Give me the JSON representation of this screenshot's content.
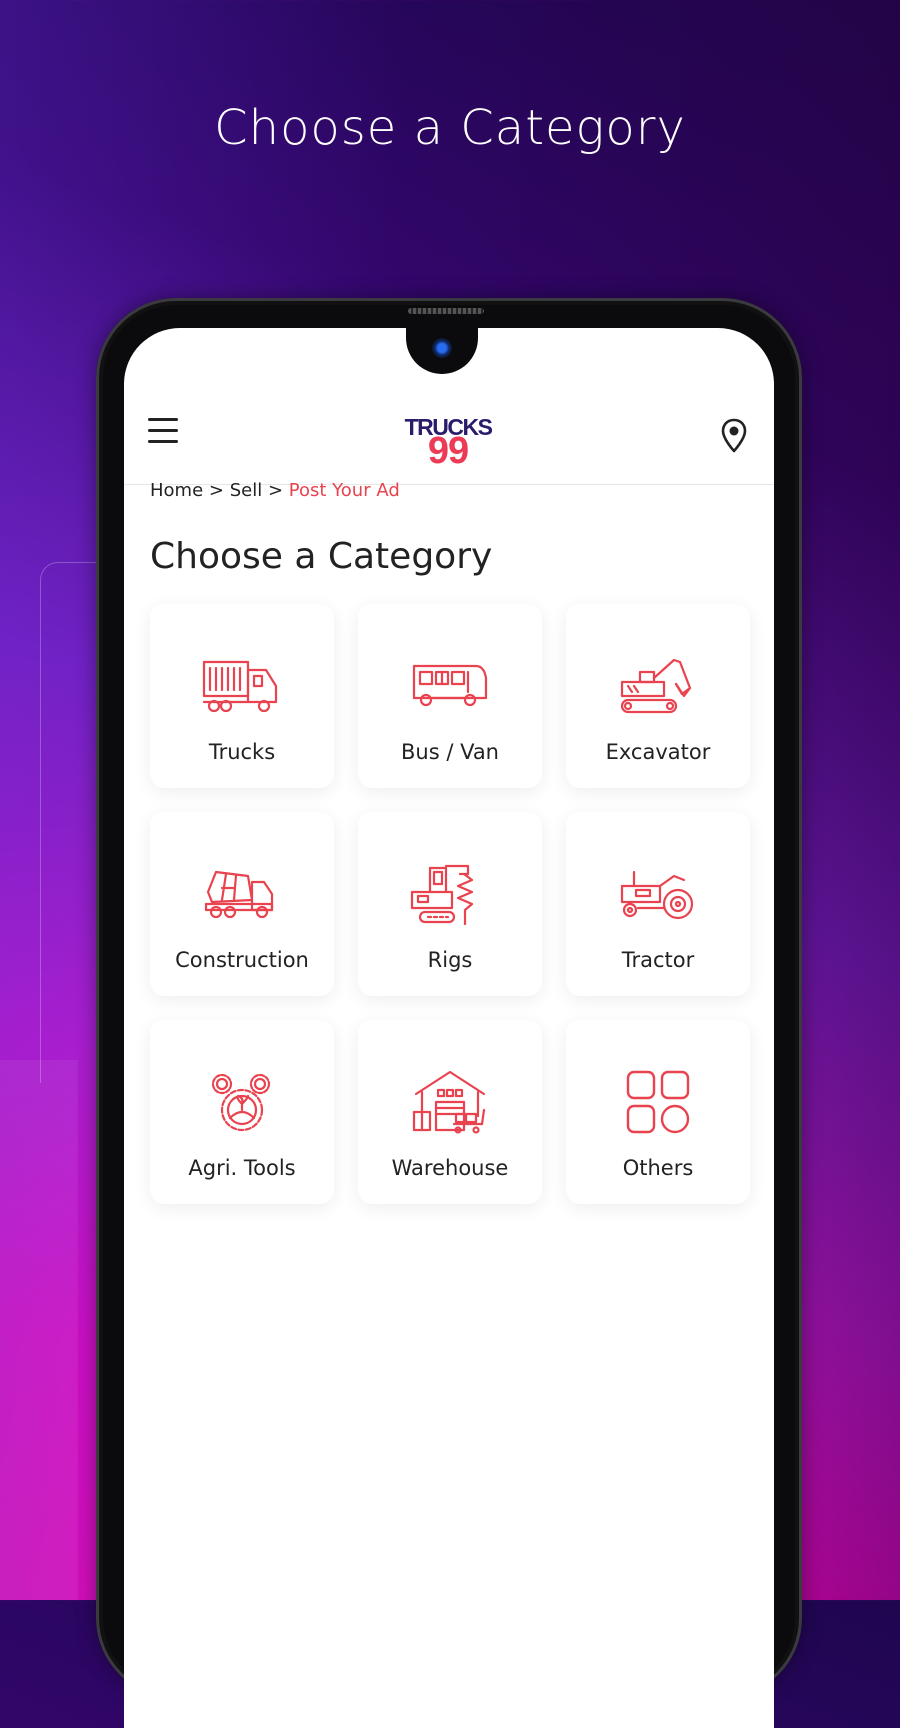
{
  "promo": {
    "title": "Choose a Category"
  },
  "header": {
    "logo_top": "TRUCKS",
    "logo_bottom": "99",
    "menu_icon": "hamburger-menu-icon",
    "location_icon": "location-pin-icon"
  },
  "breadcrumb": {
    "items": [
      "Home",
      "Sell",
      "Post Your Ad"
    ],
    "separator": ">"
  },
  "page": {
    "title": "Choose a Category"
  },
  "categories": [
    {
      "label": "Trucks",
      "icon": "truck-icon"
    },
    {
      "label": "Bus / Van",
      "icon": "bus-icon"
    },
    {
      "label": "Excavator",
      "icon": "excavator-icon"
    },
    {
      "label": "Construction",
      "icon": "cement-mixer-icon"
    },
    {
      "label": "Rigs",
      "icon": "drilling-rig-icon"
    },
    {
      "label": "Tractor",
      "icon": "tractor-icon"
    },
    {
      "label": "Agri. Tools",
      "icon": "gears-plant-icon"
    },
    {
      "label": "Warehouse",
      "icon": "warehouse-icon"
    },
    {
      "label": "Others",
      "icon": "grid-icon"
    }
  ],
  "colors": {
    "accent": "#e8434f",
    "logo_navy": "#2b1b6b",
    "text": "#222222"
  }
}
